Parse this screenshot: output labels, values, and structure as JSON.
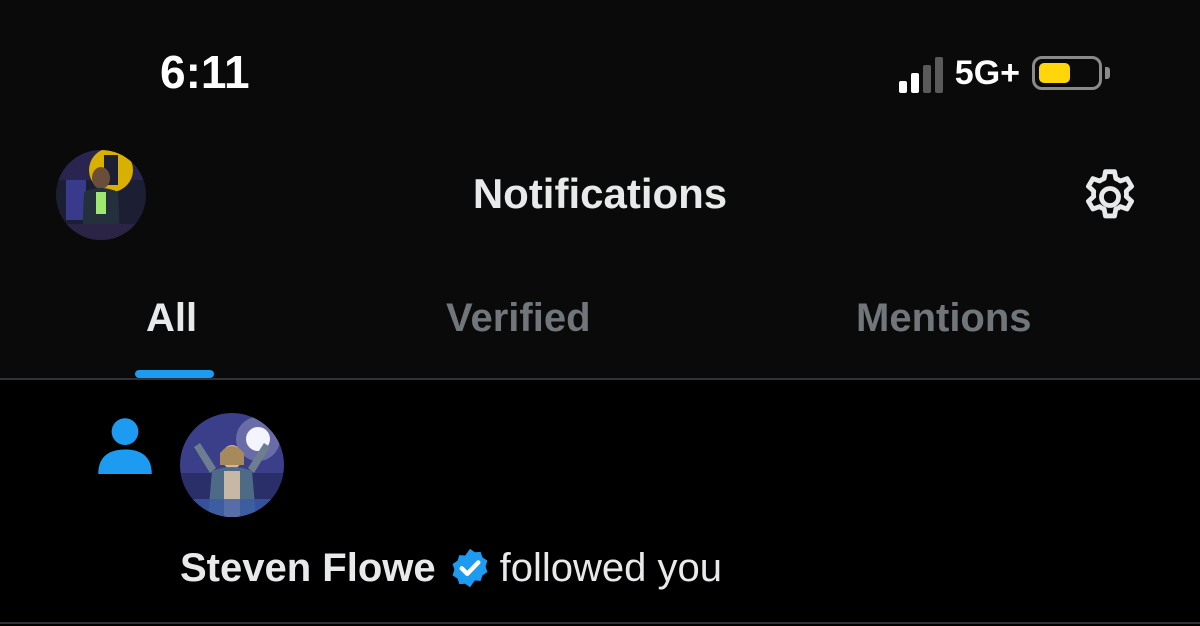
{
  "status_bar": {
    "time": "6:11",
    "network": "5G+",
    "signal_bars_active": 2,
    "signal_bars_total": 4,
    "battery_level": 0.55,
    "battery_color": "#ffd60a"
  },
  "header": {
    "title": "Notifications",
    "avatar_icon": "user-avatar",
    "settings_icon": "gear-icon"
  },
  "tabs": [
    {
      "label": "All",
      "active": true
    },
    {
      "label": "Verified",
      "active": false
    },
    {
      "label": "Mentions",
      "active": false
    }
  ],
  "notification": {
    "type_icon": "person-icon",
    "user_name": "Steven Flowe",
    "verified": true,
    "action": "followed you"
  },
  "colors": {
    "accent": "#1d9bf0",
    "background": "#000000",
    "text_primary": "#e7e9ea",
    "text_secondary": "#71767b"
  }
}
